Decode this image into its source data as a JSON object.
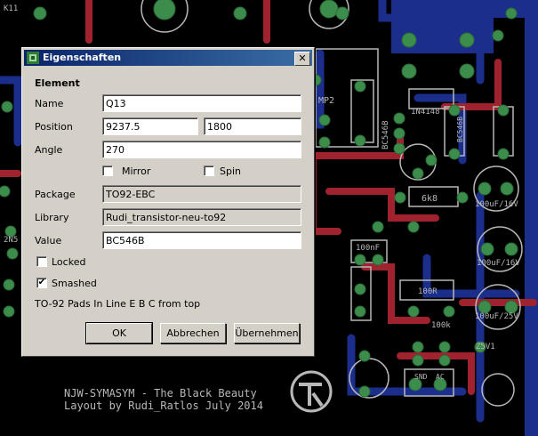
{
  "window": {
    "title": "Eigenschaften",
    "close_glyph": "✕"
  },
  "element": {
    "heading": "Element",
    "name_label": "Name",
    "name_value": "Q13",
    "position_label": "Position",
    "position_x": "9237.5",
    "position_y": "1800",
    "angle_label": "Angle",
    "angle_value": "270",
    "mirror_label": "Mirror",
    "mirror_checked": false,
    "spin_label": "Spin",
    "spin_checked": false,
    "package_label": "Package",
    "package_value": "TO92-EBC",
    "library_label": "Library",
    "library_value": "Rudi_transistor-neu-to92",
    "value_label": "Value",
    "value_value": "BC546B",
    "locked_label": "Locked",
    "locked_checked": false,
    "smashed_label": "Smashed",
    "smashed_checked": true,
    "description": "TO-92 Pads In Line E B C from top",
    "check_glyph": "✔"
  },
  "buttons": {
    "ok": "OK",
    "cancel": "Abbrechen",
    "apply": "Übernehmen"
  },
  "pcb": {
    "labels": [
      "NJW-SYMASYM - The Black Beauty",
      "Layout by Rudi_Ratlos July 2014",
      "MP2",
      "BC546B",
      "1N4148",
      "6k8",
      "100nF",
      "100R",
      "100uF/16V",
      "100uF/16V",
      "100uF/25V",
      "Z5V1",
      "SND",
      "AC",
      "K11",
      "2N5",
      "100k",
      "BC546B"
    ],
    "colors": {
      "board": "#000000",
      "top": "#a0222e",
      "bottom": "#1c2e8c",
      "pad": "#3c8c4c",
      "silk": "#b8b8b8"
    }
  }
}
